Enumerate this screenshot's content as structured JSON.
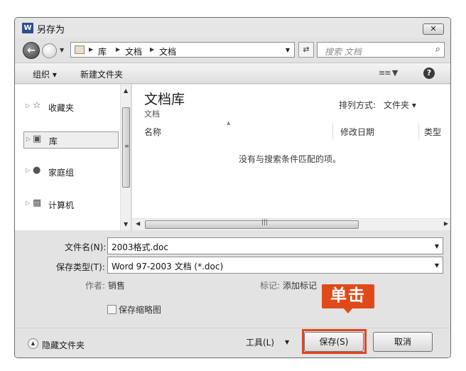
{
  "window": {
    "title": "另存为",
    "app_icon": "W",
    "close": "✕"
  },
  "address_bar": {
    "crumbs": [
      "库",
      "文档",
      "文档"
    ],
    "search_placeholder": "搜索 文档"
  },
  "toolbar": {
    "organize": "组织 ▾",
    "new_folder": "新建文件夹"
  },
  "nav": {
    "items": [
      {
        "label": "收藏夹",
        "icon": "star-icon"
      },
      {
        "label": "库",
        "icon": "library-icon"
      },
      {
        "label": "家庭组",
        "icon": "homegroup-icon"
      },
      {
        "label": "计算机",
        "icon": "computer-icon"
      }
    ]
  },
  "content": {
    "library_title": "文档库",
    "library_subtitle": "文档",
    "sort_label": "排列方式:",
    "sort_value": "文件夹 ▾",
    "columns": [
      "名称",
      "修改日期",
      "类型"
    ],
    "empty_message": "没有与搜索条件匹配的项。"
  },
  "form": {
    "filename_label": "文件名(N):",
    "filename_value": "2003格式.doc",
    "filetype_label": "保存类型(T):",
    "filetype_value": "Word 97-2003 文档 (*.doc)",
    "author_label": "作者:",
    "author_value": "销售",
    "tags_label": "标记:",
    "tags_value": "添加标记",
    "thumbnail_label": "保存缩略图"
  },
  "footer": {
    "hide_folders": "隐藏文件夹",
    "tools": "工具(L)",
    "save": "保存(S)",
    "cancel": "取消"
  },
  "annotation": {
    "callout": "单击",
    "color": "#e04a1a"
  }
}
